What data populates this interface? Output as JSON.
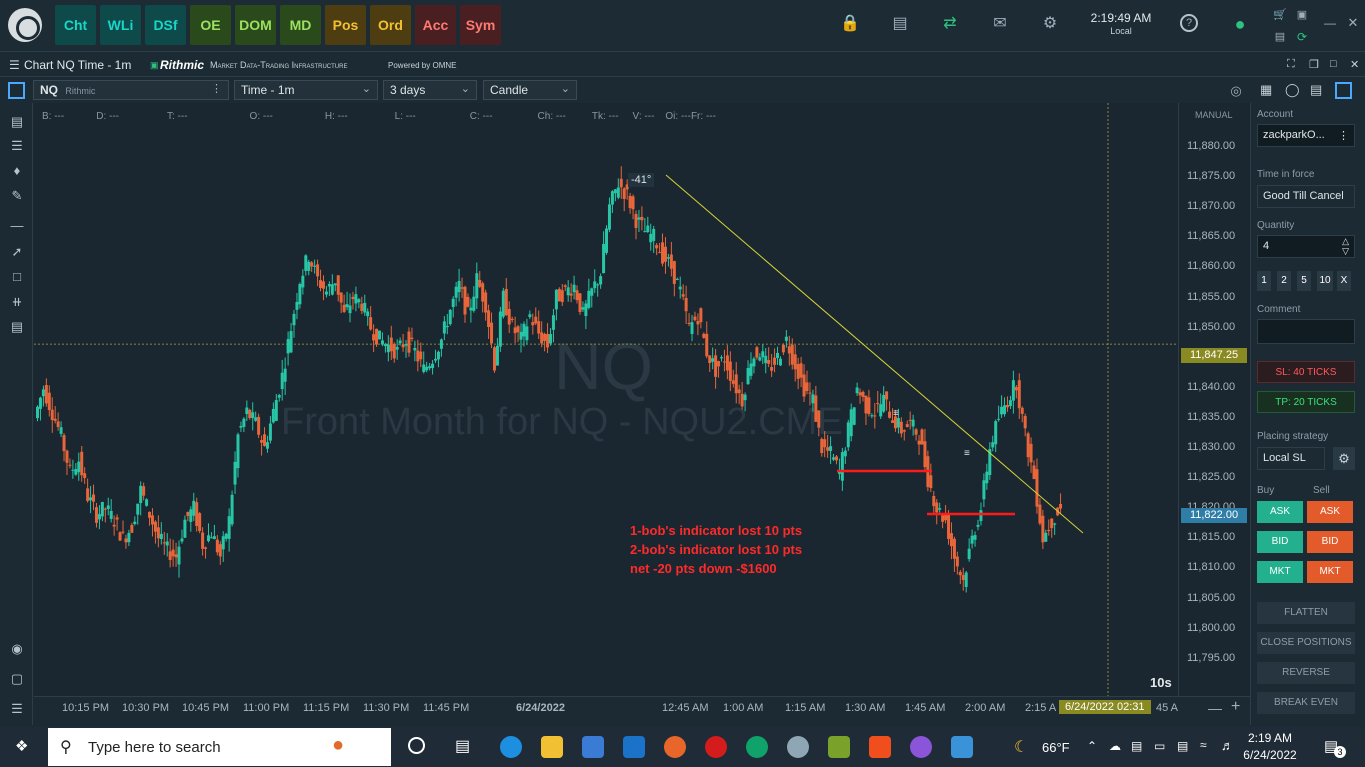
{
  "toolbar": {
    "buttons": [
      {
        "label": "Cht",
        "style": "teal"
      },
      {
        "label": "WLi",
        "style": "teal"
      },
      {
        "label": "DSf",
        "style": "teal"
      },
      {
        "label": "OE",
        "style": "green"
      },
      {
        "label": "DOM",
        "style": "green"
      },
      {
        "label": "MD",
        "style": "green"
      },
      {
        "label": "Pos",
        "style": "gold"
      },
      {
        "label": "Ord",
        "style": "gold"
      },
      {
        "label": "Acc",
        "style": "red"
      },
      {
        "label": "Sym",
        "style": "red"
      }
    ],
    "clock_time": "2:19:49 AM",
    "clock_zone": "Local"
  },
  "titlebar": {
    "title": "Chart NQ Time - 1m",
    "rithmic_brand": "Rithmic",
    "tagline": "Market Data-Trading Infrastructure",
    "powered": "Powered by OMNE"
  },
  "options": {
    "symbol": "NQ",
    "symbol_source": "Rithmic",
    "timeframe": "Time - 1m",
    "range": "3 days",
    "chart_style": "Candle"
  },
  "ohlc": [
    "B: ---",
    "D: ---",
    "T: ---",
    "O: ---",
    "H: ---",
    "L: ---",
    "C: ---",
    "Ch: ---",
    "Tk: ---",
    "V: ---",
    "Oi: ---",
    "Fr: ---"
  ],
  "chart_data": {
    "type": "candlestick",
    "watermark_symbol": "NQ",
    "watermark_desc": "Front Month for NQ - NQU2.CME",
    "price_axis": [
      "11,880.00",
      "11,875.00",
      "11,870.00",
      "11,865.00",
      "11,860.00",
      "11,855.00",
      "11,850.00",
      "11,845.00",
      "11,840.00",
      "11,835.00",
      "11,830.00",
      "11,825.00",
      "11,820.00",
      "11,815.00",
      "11,810.00",
      "11,805.00",
      "11,800.00",
      "11,795.00"
    ],
    "ylim": [
      11795,
      11880
    ],
    "time_axis": [
      "10:15 PM",
      "10:30 PM",
      "10:45 PM",
      "11:00 PM",
      "11:15 PM",
      "11:30 PM",
      "11:45 PM",
      "6/24/2022",
      "12:45 AM",
      "1:00 AM",
      "1:15 AM",
      "1:30 AM",
      "1:45 AM",
      "2:00 AM",
      "2:15 A",
      "6/24/2022 02:31",
      "45 A"
    ],
    "manual_label": "MANUAL",
    "crosshair_price": "11,847.25",
    "last_price": "11,822.00",
    "interval_badge": "10s",
    "trendline_angle": "-41°",
    "annotation_lines": [
      "1-bob's indicator lost 10 pts",
      "2-bob's indicator lost 10 pts",
      "net -20 pts down -$1600"
    ],
    "close_path": [
      11835,
      11840,
      11836,
      11832,
      11826,
      11828,
      11822,
      11819,
      11820,
      11818,
      11815,
      11817,
      11823,
      11819,
      11815,
      11813,
      11812,
      11818,
      11820,
      11814,
      11816,
      11812,
      11818,
      11832,
      11836,
      11834,
      11830,
      11836,
      11842,
      11850,
      11858,
      11862,
      11858,
      11856,
      11858,
      11852,
      11855,
      11854,
      11850,
      11848,
      11847,
      11846,
      11848,
      11846,
      11843,
      11845,
      11848,
      11853,
      11857,
      11852,
      11858,
      11854,
      11844,
      11855,
      11850,
      11848,
      11852,
      11849,
      11847,
      11855,
      11856,
      11857,
      11852,
      11856,
      11859,
      11870,
      11874,
      11872,
      11868,
      11866,
      11865,
      11862,
      11860,
      11856,
      11850,
      11852,
      11846,
      11843,
      11845,
      11841,
      11838,
      11845,
      11846,
      11843,
      11845,
      11848,
      11844,
      11840,
      11838,
      11830,
      11829,
      11826,
      11833,
      11840,
      11837,
      11836,
      11838,
      11835,
      11833,
      11834,
      11832,
      11825,
      11820,
      11818,
      11812,
      11808,
      11815,
      11820,
      11830,
      11835,
      11838,
      11841,
      11832,
      11825,
      11815,
      11818,
      11820
    ]
  },
  "panel": {
    "account_label": "Account",
    "account": "zackparkO...",
    "tif_label": "Time in force",
    "tif": "Good Till Cancel",
    "qty_label": "Quantity",
    "qty": "4",
    "qty_buttons": [
      "1",
      "2",
      "5",
      "10",
      "X"
    ],
    "comment_label": "Comment",
    "sl": "SL: 40 TICKS",
    "tp": "TP: 20 TICKS",
    "strategy_label": "Placing strategy",
    "strategy": "Local SL",
    "buy_label": "Buy",
    "sell_label": "Sell",
    "ask": "ASK",
    "bid": "BID",
    "mkt": "MKT",
    "flatten": "FLATTEN",
    "close_positions": "CLOSE POSITIONS",
    "reverse": "REVERSE",
    "break_even": "BREAK EVEN"
  },
  "taskbar": {
    "search_placeholder": "Type here to search",
    "weather": "66°F",
    "time": "2:19 AM",
    "date": "6/24/2022",
    "notif_count": "3"
  }
}
